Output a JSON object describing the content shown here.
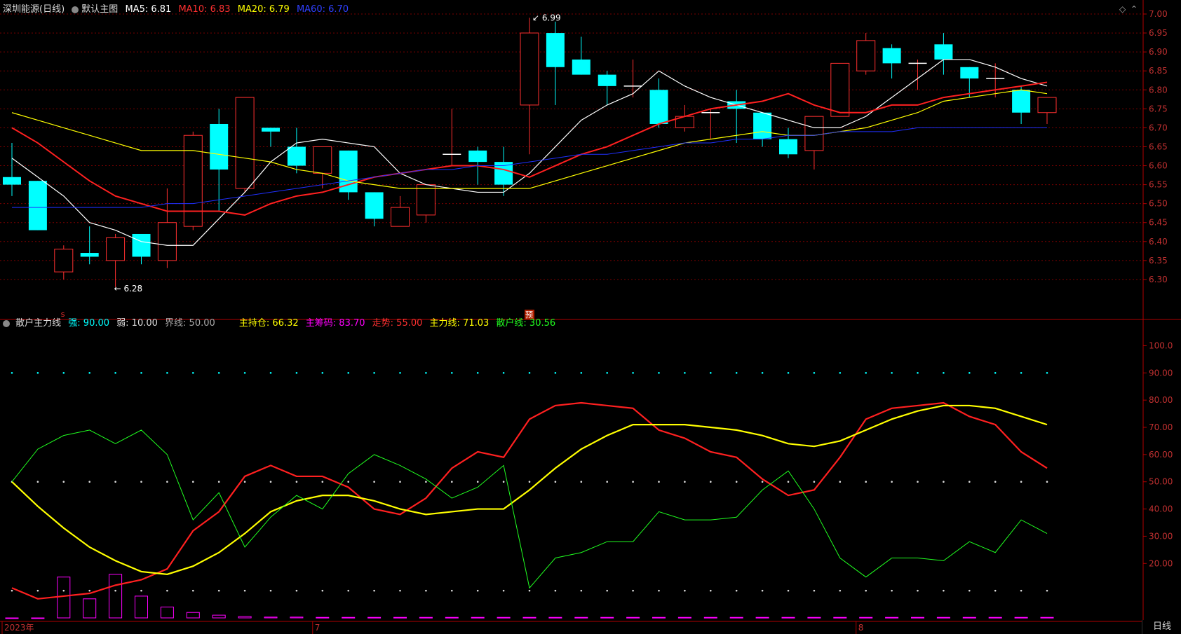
{
  "top_panel": {
    "stock_name": "深圳能源(日线)",
    "chart_name": "默认主图",
    "ma5": {
      "label": "MA5: 6.81",
      "color": "#ffffff"
    },
    "ma10": {
      "label": "MA10: 6.83",
      "color": "#ff2020"
    },
    "ma20": {
      "label": "MA20: 6.79",
      "color": "#ffff00"
    },
    "ma60": {
      "label": "MA60: 6.70",
      "color": "#2030ff"
    }
  },
  "bottom_panel": {
    "indicator_name": "散户主力线",
    "strong": {
      "label": "强: 90.00",
      "color": "#00ffff"
    },
    "weak": {
      "label": "弱: 10.00",
      "color": "#dddddd"
    },
    "boundary": {
      "label": "界线: 50.00",
      "color": "#aaaaaa"
    },
    "holding": {
      "label": "主持仓: 66.32",
      "color": "#ffff00"
    },
    "chips": {
      "label": "主筹码: 83.70",
      "color": "#ff00ff"
    },
    "trend": {
      "label": "走势: 55.00",
      "color": "#ff2020"
    },
    "main_line": {
      "label": "主力线: 71.03",
      "color": "#ffff00"
    },
    "retail_line": {
      "label": "散户线: 30.56",
      "color": "#20ff20"
    }
  },
  "bottom_bar": {
    "date_labels": [
      "2023年",
      "7",
      "8"
    ],
    "period_tab": "日线"
  },
  "markers": {
    "max_label": "6.99",
    "min_label": "6.28",
    "pre_label": "预",
    "event_label": "s"
  },
  "colors": {
    "up": "#ff3030",
    "down": "#00ffff",
    "grid": "#7a0000"
  },
  "chart_data": [
    {
      "type": "candlestick",
      "ylim": [
        6.25,
        7.0
      ],
      "yticks": [
        "7.00",
        "6.95",
        "6.90",
        "6.85",
        "6.80",
        "6.75",
        "6.70",
        "6.65",
        "6.60",
        "6.55",
        "6.50",
        "6.45",
        "6.40",
        "6.35",
        "6.30"
      ],
      "candles": [
        [
          6.57,
          6.66,
          6.52,
          6.55
        ],
        [
          6.56,
          6.56,
          6.43,
          6.43
        ],
        [
          6.32,
          6.39,
          6.3,
          6.38
        ],
        [
          6.37,
          6.44,
          6.34,
          6.36
        ],
        [
          6.35,
          6.42,
          6.28,
          6.41
        ],
        [
          6.42,
          6.42,
          6.34,
          6.36
        ],
        [
          6.35,
          6.54,
          6.33,
          6.45
        ],
        [
          6.44,
          6.69,
          6.43,
          6.68
        ],
        [
          6.71,
          6.75,
          6.48,
          6.59
        ],
        [
          6.54,
          6.78,
          6.53,
          6.78
        ],
        [
          6.7,
          6.7,
          6.65,
          6.69
        ],
        [
          6.65,
          6.7,
          6.58,
          6.6
        ],
        [
          6.58,
          6.65,
          6.54,
          6.65
        ],
        [
          6.64,
          6.64,
          6.51,
          6.53
        ],
        [
          6.53,
          6.53,
          6.44,
          6.46
        ],
        [
          6.44,
          6.52,
          6.44,
          6.49
        ],
        [
          6.47,
          6.55,
          6.45,
          6.55
        ],
        [
          6.63,
          6.75,
          6.6,
          6.63
        ],
        [
          6.64,
          6.65,
          6.55,
          6.61
        ],
        [
          6.61,
          6.65,
          6.52,
          6.55
        ],
        [
          6.76,
          6.99,
          6.63,
          6.95
        ],
        [
          6.95,
          6.98,
          6.76,
          6.86
        ],
        [
          6.88,
          6.94,
          6.84,
          6.84
        ],
        [
          6.84,
          6.85,
          6.76,
          6.81
        ],
        [
          6.81,
          6.88,
          6.78,
          6.81
        ],
        [
          6.8,
          6.83,
          6.7,
          6.71
        ],
        [
          6.7,
          6.76,
          6.69,
          6.73
        ],
        [
          6.74,
          6.75,
          6.67,
          6.74
        ],
        [
          6.77,
          6.8,
          6.66,
          6.75
        ],
        [
          6.74,
          6.74,
          6.65,
          6.67
        ],
        [
          6.67,
          6.7,
          6.62,
          6.63
        ],
        [
          6.64,
          6.73,
          6.59,
          6.73
        ],
        [
          6.73,
          6.87,
          6.73,
          6.87
        ],
        [
          6.85,
          6.95,
          6.84,
          6.93
        ],
        [
          6.91,
          6.92,
          6.83,
          6.87
        ],
        [
          6.87,
          6.88,
          6.8,
          6.87
        ],
        [
          6.92,
          6.95,
          6.84,
          6.88
        ],
        [
          6.86,
          6.86,
          6.78,
          6.83
        ],
        [
          6.83,
          6.87,
          6.78,
          6.83
        ],
        [
          6.8,
          6.81,
          6.71,
          6.74
        ],
        [
          6.74,
          6.78,
          6.71,
          6.78
        ]
      ],
      "series": [
        {
          "name": "MA5",
          "color": "#ffffff",
          "values": [
            6.62,
            6.57,
            6.52,
            6.45,
            6.43,
            6.4,
            6.39,
            6.39,
            6.46,
            6.53,
            6.61,
            6.66,
            6.67,
            6.66,
            6.65,
            6.58,
            6.55,
            6.54,
            6.53,
            6.53,
            6.58,
            6.65,
            6.72,
            6.76,
            6.79,
            6.85,
            6.81,
            6.78,
            6.76,
            6.74,
            6.72,
            6.7,
            6.7,
            6.73,
            6.78,
            6.83,
            6.88,
            6.88,
            6.86,
            6.83,
            6.81
          ]
        },
        {
          "name": "MA10",
          "color": "#ff2020",
          "values": [
            6.7,
            6.66,
            6.61,
            6.56,
            6.52,
            6.5,
            6.48,
            6.48,
            6.48,
            6.47,
            6.5,
            6.52,
            6.53,
            6.55,
            6.57,
            6.58,
            6.59,
            6.6,
            6.6,
            6.59,
            6.57,
            6.6,
            6.63,
            6.65,
            6.68,
            6.71,
            6.73,
            6.75,
            6.76,
            6.77,
            6.79,
            6.76,
            6.74,
            6.74,
            6.76,
            6.76,
            6.78,
            6.79,
            6.8,
            6.81,
            6.82
          ]
        },
        {
          "name": "MA20",
          "color": "#ffff00",
          "values": [
            6.74,
            6.72,
            6.7,
            6.68,
            6.66,
            6.64,
            6.64,
            6.64,
            6.63,
            6.62,
            6.61,
            6.59,
            6.58,
            6.56,
            6.55,
            6.54,
            6.54,
            6.54,
            6.54,
            6.54,
            6.54,
            6.56,
            6.58,
            6.6,
            6.62,
            6.64,
            6.66,
            6.67,
            6.68,
            6.69,
            6.68,
            6.68,
            6.69,
            6.7,
            6.72,
            6.74,
            6.77,
            6.78,
            6.79,
            6.8,
            6.79
          ]
        },
        {
          "name": "MA60",
          "color": "#2030ff",
          "values": [
            6.49,
            6.49,
            6.49,
            6.49,
            6.49,
            6.49,
            6.5,
            6.5,
            6.51,
            6.52,
            6.53,
            6.54,
            6.55,
            6.56,
            6.57,
            6.58,
            6.59,
            6.59,
            6.6,
            6.6,
            6.61,
            6.62,
            6.63,
            6.63,
            6.64,
            6.65,
            6.66,
            6.66,
            6.67,
            6.67,
            6.68,
            6.68,
            6.69,
            6.69,
            6.69,
            6.7,
            6.7,
            6.7,
            6.7,
            6.7,
            6.7
          ]
        }
      ]
    },
    {
      "type": "line",
      "ylim": [
        0,
        105
      ],
      "yticks": [
        "100.0",
        "90.00",
        "80.00",
        "70.00",
        "60.00",
        "50.00",
        "40.00",
        "30.00",
        "20.00"
      ],
      "reference_lines": [
        {
          "value": 90,
          "color": "#00ffff"
        },
        {
          "value": 50,
          "color": "#dddddd"
        },
        {
          "value": 10,
          "color": "#dddddd"
        }
      ],
      "series": [
        {
          "name": "走势",
          "color": "#ff2020",
          "values": [
            11,
            7,
            8,
            9,
            12,
            14,
            18,
            32,
            39,
            52,
            56,
            52,
            52,
            48,
            40,
            38,
            44,
            55,
            61,
            59,
            73,
            78,
            79,
            78,
            77,
            69,
            66,
            61,
            59,
            51,
            45,
            47,
            59,
            73,
            77,
            78,
            79,
            74,
            71,
            61,
            55
          ]
        },
        {
          "name": "主力线",
          "color": "#ffff00",
          "values": [
            50,
            41,
            33,
            26,
            21,
            17,
            16,
            19,
            24,
            31,
            39,
            43,
            45,
            45,
            43,
            40,
            38,
            39,
            40,
            40,
            47,
            55,
            62,
            67,
            71,
            71,
            71,
            70,
            69,
            67,
            64,
            63,
            65,
            69,
            73,
            76,
            78,
            78,
            77,
            74,
            71
          ]
        },
        {
          "name": "散户线",
          "color": "#20ff20",
          "values": [
            50,
            62,
            67,
            69,
            64,
            69,
            60,
            36,
            46,
            26,
            37,
            45,
            40,
            53,
            60,
            56,
            51,
            44,
            48,
            56,
            11,
            22,
            24,
            28,
            28,
            39,
            36,
            36,
            37,
            47,
            54,
            40,
            22,
            15,
            22,
            22,
            21,
            28,
            24,
            36,
            31
          ]
        },
        {
          "name": "主筹码",
          "color": "#ff00ff",
          "values": [
            0,
            0,
            15,
            7,
            16,
            8,
            4,
            2,
            1,
            0.5,
            0.3,
            0.3,
            0.2,
            0.2,
            0.2,
            0.2,
            0.2,
            0.2,
            0.2,
            0.2,
            0.2,
            0.2,
            0.2,
            0.2,
            0.2,
            0.2,
            0.2,
            0.2,
            0.2,
            0.2,
            0.2,
            0.2,
            0.2,
            0.2,
            0.2,
            0.2,
            0.2,
            0.2,
            0.2,
            0.2,
            0.2
          ]
        }
      ]
    }
  ]
}
